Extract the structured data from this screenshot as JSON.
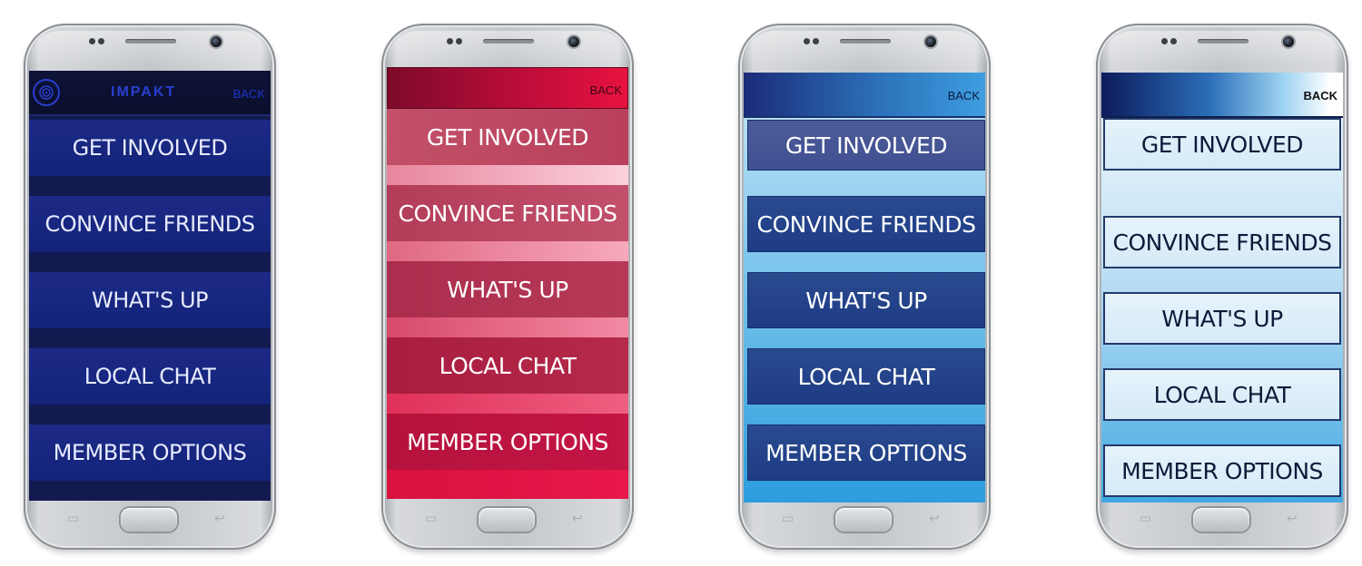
{
  "menu_labels": [
    "GET INVOLVED",
    "CONVINCE FRIENDS",
    "WHAT'S UP",
    "LOCAL CHAT",
    "MEMBER OPTIONS"
  ],
  "phones": [
    {
      "theme": "dark-blue",
      "app_title": "IMPAKT",
      "logo_icon": "fingerprint-icon",
      "back": "BACK",
      "colors": {
        "background": "#131a4f",
        "button": "#1c2a86",
        "text": "#e7ebff",
        "accent": "#2a3ed0"
      },
      "buttons": [
        "GET INVOLVED",
        "CONVINCE FRIENDS",
        "WHAT'S UP",
        "LOCAL CHAT",
        "MEMBER OPTIONS"
      ]
    },
    {
      "theme": "crimson",
      "back": "BACK",
      "colors": {
        "header": "#c10d3b",
        "text": "#ffffff"
      },
      "buttons": [
        "GET INVOLVED",
        "CONVINCE FRIENDS",
        "WHAT'S UP",
        "LOCAL CHAT",
        "MEMBER OPTIONS"
      ]
    },
    {
      "theme": "sky-blue",
      "back": "BACK",
      "colors": {
        "header": "#2b70b8",
        "button": "#1e3c84",
        "text": "#ffffff"
      },
      "buttons": [
        "GET INVOLVED",
        "CONVINCE FRIENDS",
        "WHAT'S UP",
        "LOCAL CHAT",
        "MEMBER OPTIONS"
      ]
    },
    {
      "theme": "light-outlined",
      "back": "BACK",
      "colors": {
        "header": "#0c1a5c",
        "button": "#e6f3fb",
        "border": "#233a6a",
        "text": "#0d1b3a"
      },
      "buttons": [
        "GET INVOLVED",
        "CONVINCE FRIENDS",
        "WHAT'S UP",
        "LOCAL CHAT",
        "MEMBER OPTIONS"
      ]
    }
  ],
  "phone_keys": {
    "recent": "▭",
    "back": "↩"
  }
}
